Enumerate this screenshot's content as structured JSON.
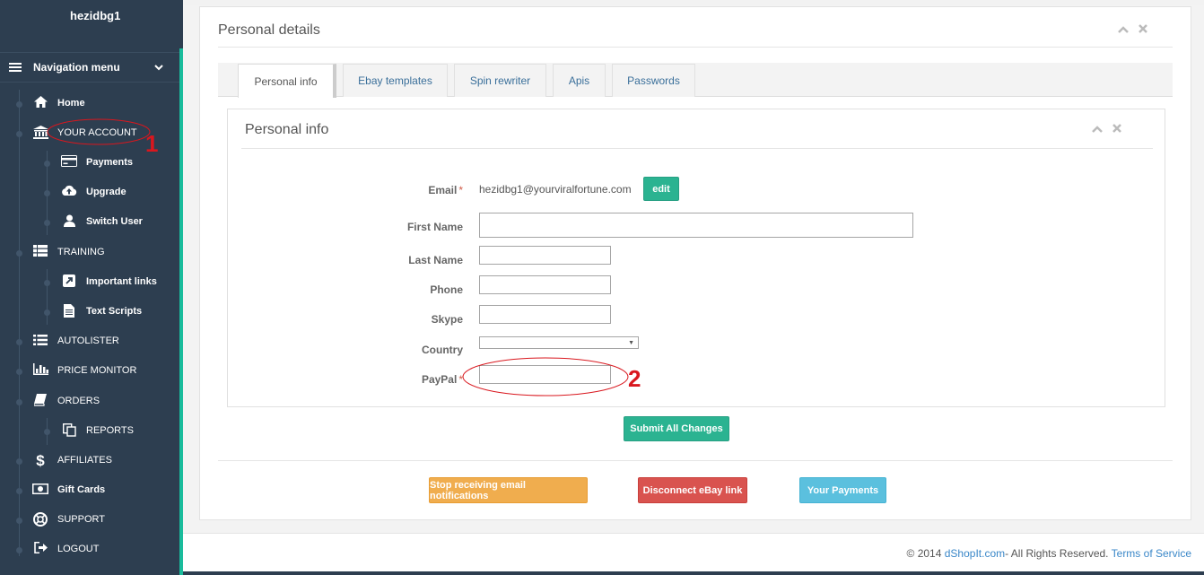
{
  "user": {
    "name": "hezidbg1"
  },
  "nav": {
    "menu_label": "Navigation menu",
    "items": [
      {
        "label": "Home",
        "icon": "home-icon",
        "sub": false
      },
      {
        "label": "YOUR ACCOUNT",
        "icon": "bank-icon",
        "sub": false
      },
      {
        "label": "Payments",
        "icon": "credit-card-icon",
        "sub": true
      },
      {
        "label": "Upgrade",
        "icon": "cloud-upload-icon",
        "sub": true
      },
      {
        "label": "Switch User",
        "icon": "user-icon",
        "sub": true
      },
      {
        "label": "TRAINING",
        "icon": "list-icon",
        "sub": false
      },
      {
        "label": "Important links",
        "icon": "external-link-icon",
        "sub": true
      },
      {
        "label": "Text Scripts",
        "icon": "file-text-icon",
        "sub": true
      },
      {
        "label": "AUTOLISTER",
        "icon": "list-ul-icon",
        "sub": false
      },
      {
        "label": "PRICE MONITOR",
        "icon": "bar-chart-icon",
        "sub": false
      },
      {
        "label": "ORDERS",
        "icon": "book-icon",
        "sub": false
      },
      {
        "label": "REPORTS",
        "icon": "copy-icon",
        "sub": true
      },
      {
        "label": "AFFILIATES",
        "icon": "dollar-icon",
        "sub": false
      },
      {
        "label": "Gift Cards",
        "icon": "money-icon",
        "sub": false
      },
      {
        "label": "SUPPORT",
        "icon": "life-ring-icon",
        "sub": false
      },
      {
        "label": "LOGOUT",
        "icon": "sign-out-icon",
        "sub": false
      }
    ]
  },
  "panel": {
    "title": "Personal details"
  },
  "tabs": [
    "Personal info",
    "Ebay templates",
    "Spin rewriter",
    "Apis",
    "Passwords"
  ],
  "form": {
    "title": "Personal info",
    "email_label": "Email",
    "email_value": "hezidbg1@yourviralfortune.com",
    "edit_label": "edit",
    "first_name_label": "First Name",
    "last_name_label": "Last Name",
    "phone_label": "Phone",
    "skype_label": "Skype",
    "country_label": "Country",
    "paypal_label": "PayPal",
    "required_mark": "*",
    "submit_label": "Submit All Changes"
  },
  "actions": {
    "stop_email": "Stop receiving email notifications",
    "disconnect_ebay": "Disconnect eBay link",
    "your_payments": "Your Payments"
  },
  "footer": {
    "prefix": "© 2014",
    "brand": "dShopIt.com",
    "rights": "- All Rights Reserved.",
    "terms": "Terms of Service"
  },
  "annotations": {
    "one": "1",
    "two": "2"
  },
  "colors": {
    "sidebar": "#2d3e50",
    "accent": "#1abc9c",
    "annotation": "#d9171e"
  }
}
